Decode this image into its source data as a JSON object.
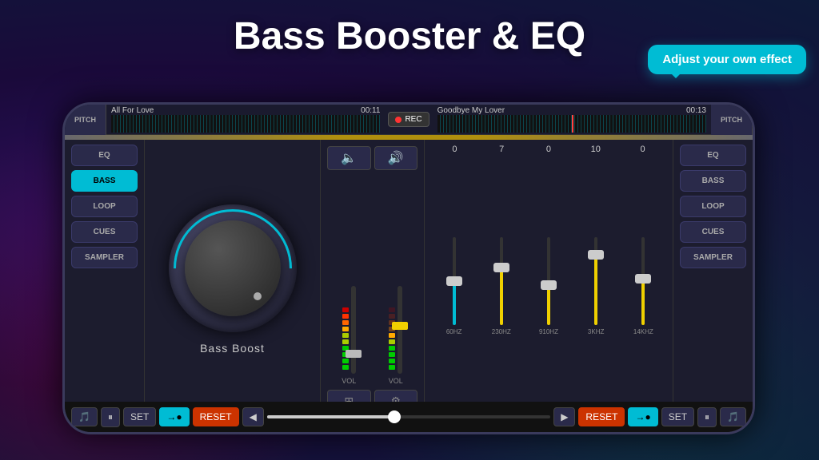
{
  "page": {
    "title": "Bass Booster & EQ",
    "bg_color": "#1a0a3a"
  },
  "tooltip": {
    "text": "Adjust your own effect"
  },
  "top_bar": {
    "pitch_label": "PITCH",
    "track_left": {
      "name": "All For Love",
      "time": "00:11"
    },
    "rec_label": "REC",
    "track_right": {
      "name": "Goodbye My Lover",
      "time": "00:13"
    },
    "pitch_right_label": "PITCH"
  },
  "left_panel": {
    "buttons": [
      {
        "label": "EQ",
        "active": false
      },
      {
        "label": "BASS",
        "active": true
      },
      {
        "label": "LOOP",
        "active": false
      },
      {
        "label": "CUES",
        "active": false
      },
      {
        "label": "SAMPLER",
        "active": false
      }
    ]
  },
  "right_panel": {
    "buttons": [
      {
        "label": "EQ",
        "active": false
      },
      {
        "label": "BASS",
        "active": false
      },
      {
        "label": "LOOP",
        "active": false
      },
      {
        "label": "CUES",
        "active": false
      },
      {
        "label": "SAMPLER",
        "active": false
      }
    ]
  },
  "knob": {
    "label": "Bass Boost"
  },
  "meter": {
    "vol_label_left": "VOL",
    "vol_label_right": "VOL"
  },
  "eq": {
    "bands": [
      {
        "freq": "60HZ",
        "value": "0",
        "fill_pct": 50,
        "thumb_pct": 50
      },
      {
        "freq": "230HZ",
        "value": "7",
        "fill_pct": 65,
        "thumb_pct": 65
      },
      {
        "freq": "910HZ",
        "value": "0",
        "fill_pct": 50,
        "thumb_pct": 50
      },
      {
        "freq": "3KHZ",
        "value": "10",
        "fill_pct": 80,
        "thumb_pct": 80
      },
      {
        "freq": "14KHZ",
        "value": "0",
        "fill_pct": 50,
        "thumb_pct": 50
      }
    ]
  },
  "transport": {
    "set_label": "SET",
    "reset_label": "RESET",
    "set_right_label": "SET"
  }
}
